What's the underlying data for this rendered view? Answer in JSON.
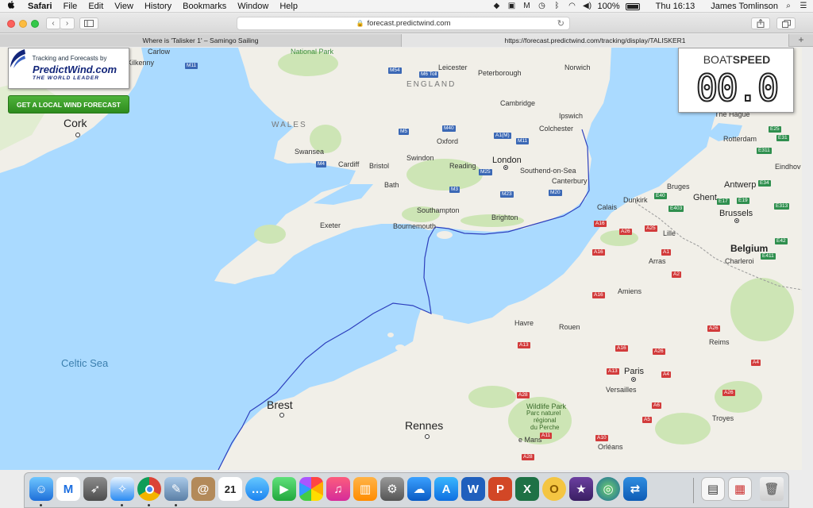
{
  "menubar": {
    "apple": "",
    "app_name": "Safari",
    "items": [
      "File",
      "Edit",
      "View",
      "History",
      "Bookmarks",
      "Window",
      "Help"
    ],
    "battery": "100%",
    "clock": "Thu 16:13",
    "user": "James Tomlinson"
  },
  "toolbar": {
    "address": "forecast.predictwind.com",
    "back": "‹",
    "forward": "›"
  },
  "tabs": [
    {
      "title": "Where is 'Talisker 1' – Samingo Sailing"
    },
    {
      "title": "https://forecast.predictwind.com/tracking/display/TALISKER1"
    }
  ],
  "overlay": {
    "tagline": "Tracking and Forecasts by",
    "brand": "PredictWind.com",
    "brand_sub": "THE WORLD LEADER",
    "forecast_button": "GET A LOCAL WIND FORECAST",
    "boatspeed_title_light": "BOAT",
    "boatspeed_title_bold": "SPEED",
    "boatspeed_value": "00.0"
  },
  "map": {
    "colors": {
      "sea": "#aadaff",
      "land": "#f1efe8",
      "park": "#cde5b5",
      "track": "#2d3fbd"
    },
    "regions": [
      "ENGLAND",
      "WALES"
    ],
    "seas": [
      "Celtic Sea"
    ],
    "parks": [
      "National Park",
      "Wildlife Park",
      "Parc naturel",
      "régional",
      "du Perche"
    ],
    "cities": {
      "kilkenny": "Kilkenny",
      "carlow": "Carlow",
      "cork": "Cork",
      "leicester": "Leicester",
      "peterborough": "Peterborough",
      "norwich": "Norwich",
      "cambridge": "Cambridge",
      "ipswich": "Ipswich",
      "colchester": "Colchester",
      "oxford": "Oxford",
      "london": "London",
      "swansea": "Swansea",
      "cardiff": "Cardiff",
      "bristol": "Bristol",
      "swindon": "Swindon",
      "reading": "Reading",
      "southend": "Southend-on-Sea",
      "bath": "Bath",
      "canterbury": "Canterbury",
      "southampton": "Southampton",
      "brighton": "Brighton",
      "exeter": "Exeter",
      "bournemouth": "Bournemouth",
      "dunkirk": "Dunkirk",
      "calais": "Calais",
      "bruges": "Bruges",
      "ghent": "Ghent",
      "antwerp": "Antwerp",
      "brussels": "Brussels",
      "belgium": "Belgium",
      "lille": "Lille",
      "arras": "Arras",
      "charleroi": "Charleroi",
      "amiens": "Amiens",
      "havre": "Havre",
      "rouen": "Rouen",
      "reims": "Reims",
      "paris": "Paris",
      "versailles": "Versailles",
      "brest": "Brest",
      "rennes": "Rennes",
      "lemans": "e Mans",
      "orleans": "Orléans",
      "troyes": "Troyes",
      "rotterdam": "Rotterdam",
      "thehague": "The Hague",
      "eindhoven": "Eindhov"
    },
    "roads": {
      "m11": "M11",
      "m54": "M54",
      "m6toll": "M6 Toll",
      "m5": "M5",
      "m40": "M40",
      "a1m": "A1(M)",
      "m11b": "M11",
      "m4": "M4",
      "m25": "M25",
      "m3": "M3",
      "m23": "M23",
      "m20": "M20",
      "a16": "A16",
      "a26": "A26",
      "a25": "A25",
      "e40": "E40",
      "e403": "E403",
      "e17": "E17",
      "e34": "E34",
      "e19": "E19",
      "e313": "E313",
      "e42": "E42",
      "e411": "E411",
      "a1": "A1",
      "a2": "A2",
      "a26b": "A26",
      "a4": "A4",
      "a13": "A13",
      "a13b": "A13",
      "a16b": "A16",
      "a28": "A28",
      "a11": "A11",
      "a6": "A6",
      "a5": "A5",
      "a10": "A10",
      "a28b": "A28",
      "e25": "E25",
      "e31": "E31",
      "e311": "E311",
      "a16c": "A16",
      "a4b": "A4",
      "a26c": "A26"
    }
  }
}
